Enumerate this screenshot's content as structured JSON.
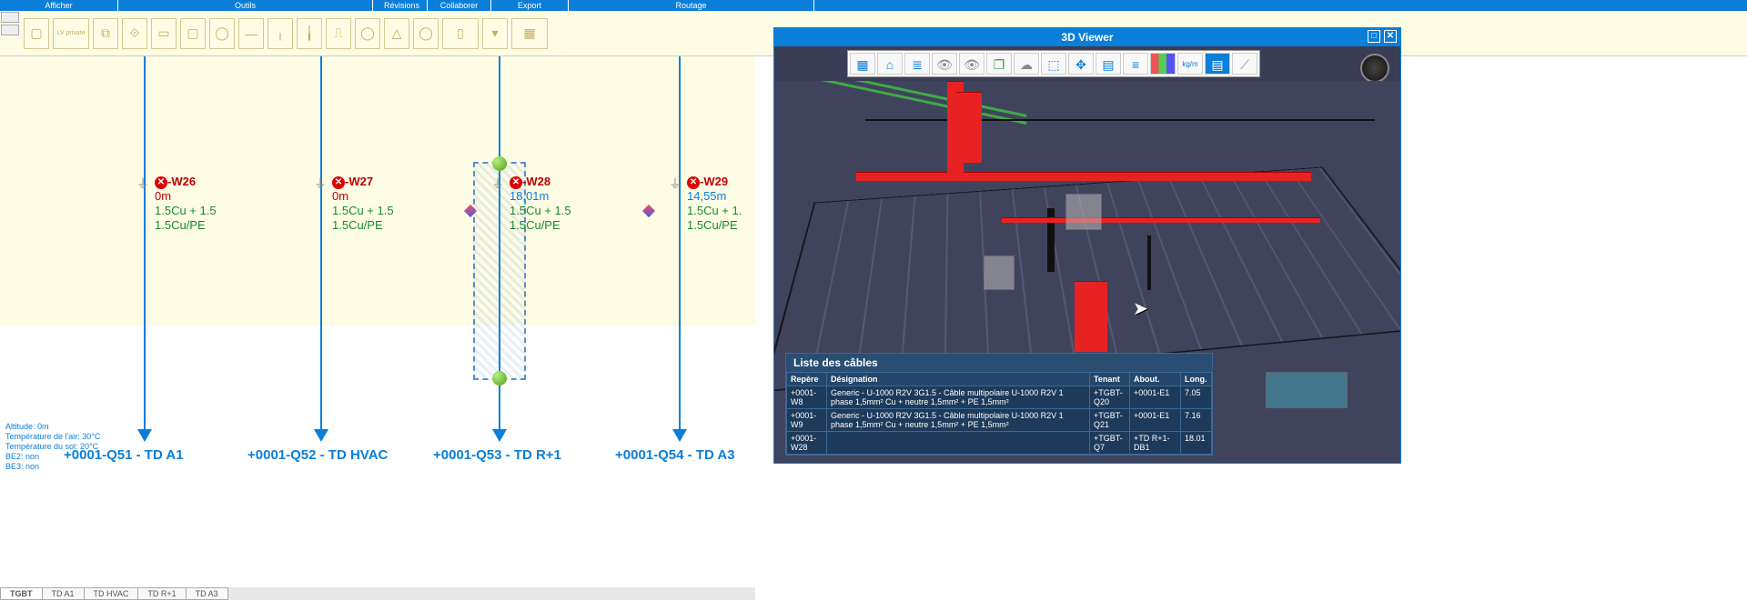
{
  "menu": {
    "afficher": "Afficher",
    "outils": "Outils",
    "revisions": "Révisions",
    "collaborer": "Collaborer",
    "export": "Export",
    "routage": "Routage"
  },
  "cables": {
    "w26": {
      "name": "-W26",
      "length": "0m",
      "spec1": "1.5Cu + 1.5",
      "spec2": "1.5Cu/PE"
    },
    "w27": {
      "name": "-W27",
      "length": "0m",
      "spec1": "1.5Cu + 1.5",
      "spec2": "1.5Cu/PE"
    },
    "w28": {
      "name": "-W28",
      "length": "18,01m",
      "spec1": "1.5Cu + 1.5",
      "spec2": "1.5Cu/PE"
    },
    "w29": {
      "name": "-W29",
      "length": "14,55m",
      "spec1": "1.5Cu + 1.",
      "spec2": "1.5Cu/PE"
    }
  },
  "circuits": {
    "c1": "+0001-Q51 - TD A1",
    "c2": "+0001-Q52 - TD HVAC",
    "c3": "+0001-Q53 - TD R+1",
    "c4": "+0001-Q54 - TD A3"
  },
  "status": {
    "alt": "Altitude: 0m",
    "tair": "Température de l'air: 30°C",
    "tsol": "Température du sol: 20°C",
    "be2": "BE2: non",
    "be3": "BE3: non"
  },
  "tabs": {
    "t1": "TGBT",
    "t2": "TD A1",
    "t3": "TD HVAC",
    "t4": "TD R+1",
    "t5": "TD A3"
  },
  "viewer": {
    "title": "3D Viewer",
    "list_title": "Liste des câbles",
    "headers": {
      "repere": "Repère",
      "designation": "Désignation",
      "tenant": "Tenant",
      "about": "About.",
      "long": "Long."
    },
    "rows": [
      {
        "repere": "+0001-W8",
        "designation": "Generic - U-1000 R2V 3G1.5 - Câble multipolaire U-1000 R2V 1 phase 1,5mm² Cu + neutre 1,5mm² + PE 1,5mm²",
        "tenant": "+TGBT-Q20",
        "about": "+0001-E1",
        "long": "7.05"
      },
      {
        "repere": "+0001-W9",
        "designation": "Generic - U-1000 R2V 3G1.5 - Câble multipolaire U-1000 R2V 1 phase 1,5mm² Cu + neutre 1,5mm² + PE 1,5mm²",
        "tenant": "+TGBT-Q21",
        "about": "+0001-E1",
        "long": "7.16"
      },
      {
        "repere": "+0001-W28",
        "designation": "",
        "tenant": "+TGBT-Q7",
        "about": "+TD R+1-DB1",
        "long": "18.01"
      }
    ]
  },
  "toolbox": {
    "lv": "LV private"
  }
}
